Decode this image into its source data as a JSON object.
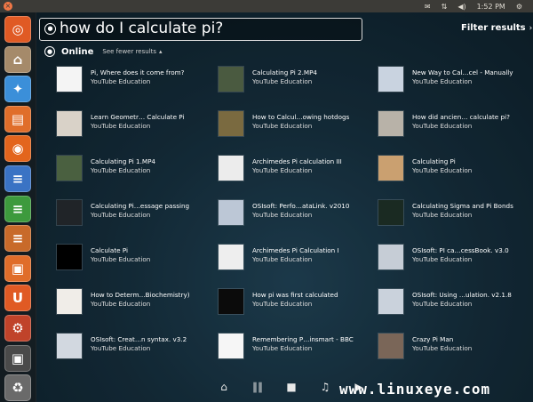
{
  "topbar": {
    "time": "1:52 PM",
    "icons": [
      "mail-icon",
      "network-icon",
      "volume-icon",
      "settings-icon"
    ]
  },
  "launcher": {
    "items": [
      {
        "name": "ubuntu-logo-icon",
        "color": "#e05a24",
        "glyph": "◎"
      },
      {
        "name": "home-folder-icon",
        "color": "#a58a6a",
        "glyph": "⌂"
      },
      {
        "name": "installer-icon",
        "color": "#3b8fd9",
        "glyph": "✦"
      },
      {
        "name": "files-icon",
        "color": "#e06e2a",
        "glyph": "▤"
      },
      {
        "name": "firefox-icon",
        "color": "#e3651d",
        "glyph": "◉"
      },
      {
        "name": "writer-icon",
        "color": "#3a73c4",
        "glyph": "≡"
      },
      {
        "name": "calc-icon",
        "color": "#3d9a3d",
        "glyph": "≡"
      },
      {
        "name": "impress-icon",
        "color": "#c86a2a",
        "glyph": "≡"
      },
      {
        "name": "software-center-icon",
        "color": "#e06d2a",
        "glyph": "▣"
      },
      {
        "name": "ubuntu-one-icon",
        "color": "#e05a24",
        "glyph": "U"
      },
      {
        "name": "system-settings-icon",
        "color": "#c0432a",
        "glyph": "⚙"
      },
      {
        "name": "workspaces-icon",
        "color": "#4a4a4a",
        "glyph": "▣"
      },
      {
        "name": "trash-icon",
        "color": "#6a6a6a",
        "glyph": "♻"
      }
    ]
  },
  "search": {
    "query": "how do I calculate pi?"
  },
  "filter": {
    "label": "Filter results",
    "chevron": "›"
  },
  "category": {
    "name": "Online",
    "fewer": "See fewer results",
    "fewer_arrow": "▴"
  },
  "results": [
    {
      "title": "Pi, Where does it come from?",
      "source": "YouTube Education",
      "thumb": "#f4f4f4"
    },
    {
      "title": "Calculating Pi 2.MP4",
      "source": "YouTube Education",
      "thumb": "#4a5a40"
    },
    {
      "title": "New Way to Cal…cel - Manually",
      "source": "YouTube Education",
      "thumb": "#c9d3e0"
    },
    {
      "title": "Learn Geometr… Calculate Pi",
      "source": "YouTube Education",
      "thumb": "#d9d2c8"
    },
    {
      "title": "How to Calcul…owing hotdogs",
      "source": "YouTube Education",
      "thumb": "#7a6a40"
    },
    {
      "title": "How did ancien… calculate pi?",
      "source": "YouTube Education",
      "thumb": "#b8b2a8"
    },
    {
      "title": "Calculating Pi 1.MP4",
      "source": "YouTube Education",
      "thumb": "#4a6040"
    },
    {
      "title": "Archimedes Pi calculation III",
      "source": "YouTube Education",
      "thumb": "#ececec"
    },
    {
      "title": "Calculating Pi",
      "source": "YouTube Education",
      "thumb": "#caa070"
    },
    {
      "title": "Calculating Pi…essage passing",
      "source": "YouTube Education",
      "thumb": "#202428"
    },
    {
      "title": "OSIsoft: Perfo…ataLink. v2010",
      "source": "YouTube Education",
      "thumb": "#bcc7d6"
    },
    {
      "title": "Calculating Sigma and Pi Bonds",
      "source": "YouTube Education",
      "thumb": "#1a2a22"
    },
    {
      "title": "Calculate Pi",
      "source": "YouTube Education",
      "thumb": "#000000"
    },
    {
      "title": "Archimedes Pi Calculation I",
      "source": "YouTube Education",
      "thumb": "#eeeeee"
    },
    {
      "title": "OSIsoft: PI ca…cessBook. v3.0",
      "source": "YouTube Education",
      "thumb": "#c6cdd6"
    },
    {
      "title": "How to Determ…Biochemistry)",
      "source": "YouTube Education",
      "thumb": "#f0ede8"
    },
    {
      "title": "How pi was first calculated",
      "source": "YouTube Education",
      "thumb": "#0b0b0b"
    },
    {
      "title": "OSIsoft: Using …ulation. v2.1.8",
      "source": "YouTube Education",
      "thumb": "#cad2dc"
    },
    {
      "title": "OSIsoft: Creat…n syntax. v3.2",
      "source": "YouTube Education",
      "thumb": "#d2d8e0"
    },
    {
      "title": "Remembering P…insmart - BBC",
      "source": "YouTube Education",
      "thumb": "#f6f6f6"
    },
    {
      "title": "Crazy Pi Man",
      "source": "YouTube Education",
      "thumb": "#7a6658"
    }
  ],
  "lenses": [
    {
      "name": "home-lens-icon",
      "glyph": "⌂"
    },
    {
      "name": "applications-lens-icon",
      "glyph": "∥∥"
    },
    {
      "name": "files-lens-icon",
      "glyph": "■"
    },
    {
      "name": "music-lens-icon",
      "glyph": "♫"
    },
    {
      "name": "video-lens-icon",
      "glyph": "▶"
    }
  ],
  "watermark": "www.linuxeye.com"
}
